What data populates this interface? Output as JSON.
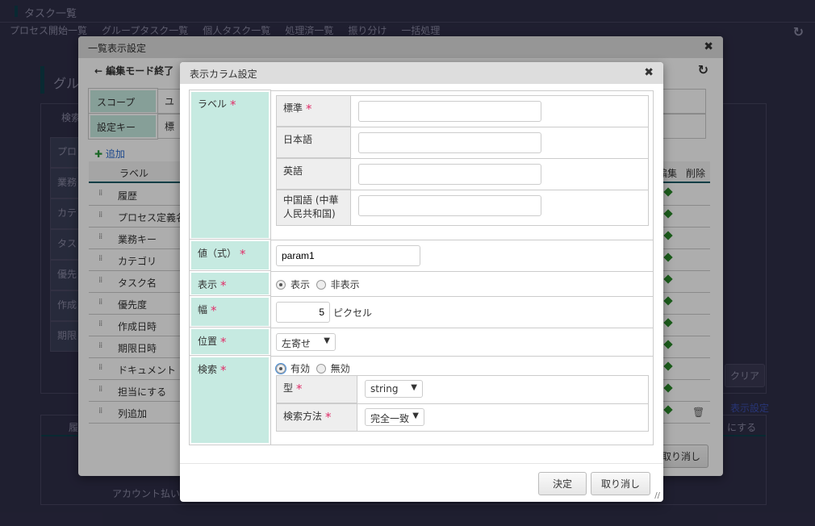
{
  "page": {
    "title": "タスク一覧",
    "nav": [
      "プロセス開始一覧",
      "グループタスク一覧",
      "個人タスク一覧",
      "処理済一覧",
      "振り分け",
      "一括処理"
    ],
    "panel_title": "グル",
    "search_toggle": "検索",
    "search_fields": [
      "プロ",
      "業務",
      "カテ",
      "タス",
      "優先",
      "作成",
      "期限"
    ],
    "clear_button": "クリア",
    "display_settings_link": "表示設定",
    "table_headers": [
      "履",
      "にする"
    ],
    "table_rows": [
      "",
      "",
      "アカウント払い"
    ]
  },
  "list_dialog": {
    "title": "一覧表示設定",
    "exit_edit": "編集モード終了",
    "scope_label": "スコープ",
    "scope_value": "ユ",
    "key_label": "設定キー",
    "key_value": "標",
    "add": "追加",
    "columns": [
      "ラベル",
      "編集",
      "削除"
    ],
    "rows": [
      "履歴",
      "プロセス定義名",
      "業務キー",
      "カテゴリ",
      "タスク名",
      "優先度",
      "作成日時",
      "期限日時",
      "ドキュメント",
      "担当にする",
      "列追加"
    ],
    "cancel": "取り消し"
  },
  "column_dialog": {
    "title": "表示カラム設定",
    "label": {
      "title": "ラベル",
      "rows": [
        {
          "name": "標準",
          "required": true,
          "value": ""
        },
        {
          "name": "日本語",
          "value": ""
        },
        {
          "name": "英語",
          "value": ""
        },
        {
          "name": "中国語 (中華人民共和国)",
          "value": ""
        }
      ]
    },
    "value": {
      "title": "値（式）",
      "value": "param1"
    },
    "display": {
      "title": "表示",
      "options": [
        "表示",
        "非表示"
      ],
      "selected": "表示"
    },
    "width": {
      "title": "幅",
      "value": "5",
      "unit": "ピクセル"
    },
    "position": {
      "title": "位置",
      "selected": "左寄せ"
    },
    "search": {
      "title": "検索",
      "options": [
        "有効",
        "無効"
      ],
      "selected": "有効",
      "type_label": "型",
      "type_value": "string",
      "method_label": "検索方法",
      "method_value": "完全一致"
    },
    "ok": "決定",
    "cancel": "取り消し"
  },
  "colors": {
    "label_bg": "#c6eae1",
    "required": "#e0306a",
    "overlay": "#2e2d45"
  }
}
